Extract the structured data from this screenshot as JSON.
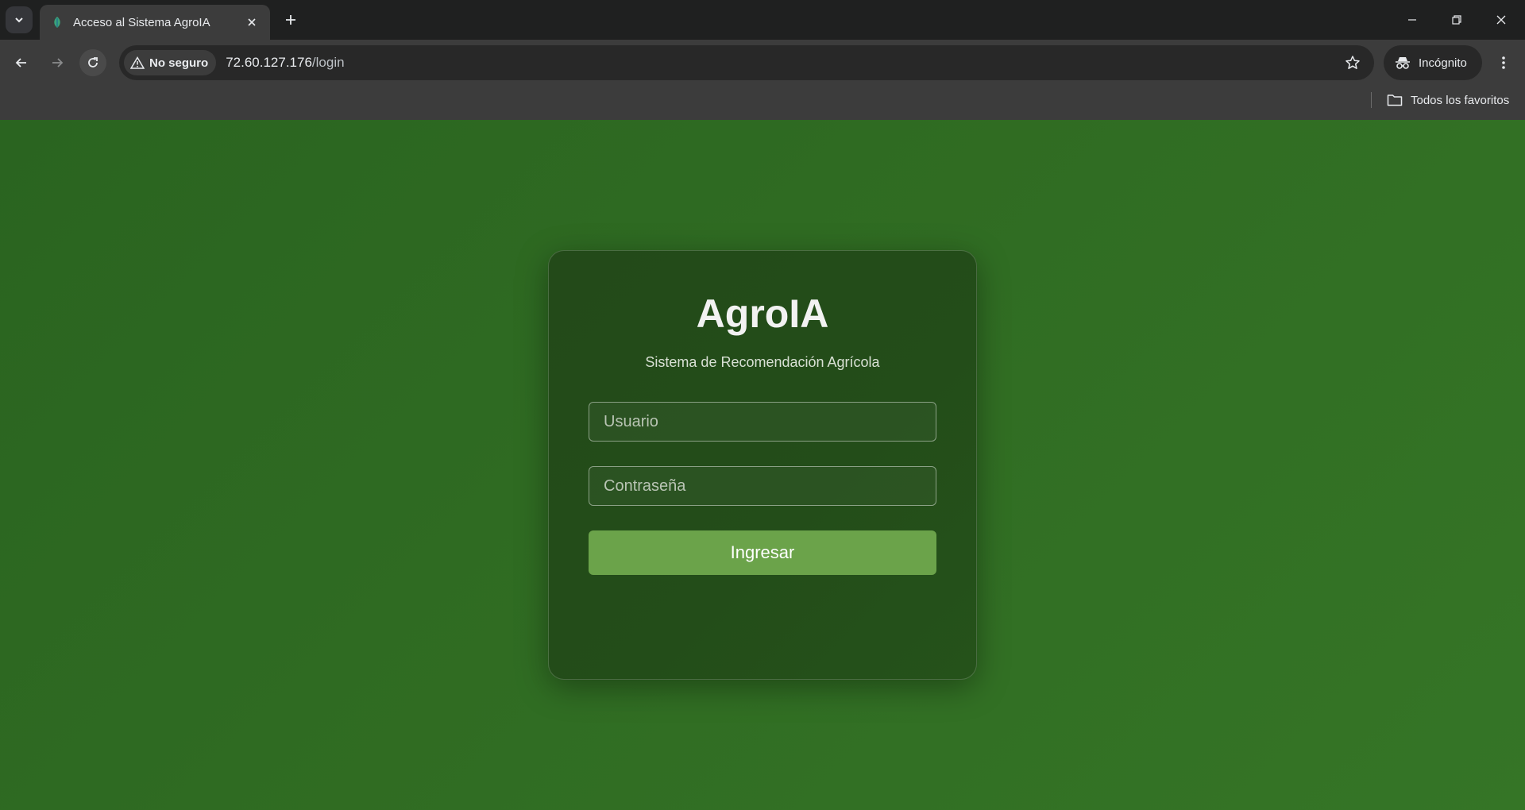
{
  "browser": {
    "tab": {
      "title": "Acceso al Sistema AgroIA",
      "favicon": "leaf-icon"
    },
    "address": {
      "security_label": "No seguro",
      "host": "72.60.127.176",
      "path": "/login"
    },
    "profile_label": "Incógnito",
    "bookmarks": {
      "all_label": "Todos los favoritos"
    }
  },
  "login": {
    "brand": "AgroIA",
    "subtitle": "Sistema de Recomendación Agrícola",
    "username_placeholder": "Usuario",
    "password_placeholder": "Contraseña",
    "submit_label": "Ingresar"
  },
  "colors": {
    "page_background": "#2f6b22",
    "card_background": "#234a19",
    "button": "#6ba34a"
  }
}
